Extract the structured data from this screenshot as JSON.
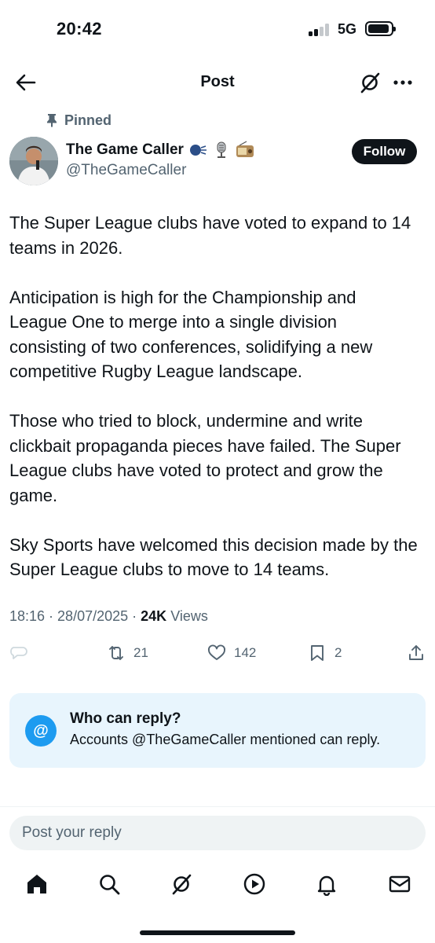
{
  "status_bar": {
    "time": "20:42",
    "network": "5G"
  },
  "header": {
    "title": "Post"
  },
  "post": {
    "pinned_label": "Pinned",
    "author_name": "The Game Caller",
    "author_handle": "@TheGameCaller",
    "follow_label": "Follow",
    "paragraphs": [
      "The Super League clubs have voted to expand to 14 teams in 2026.",
      "Anticipation is high for the Championship and League One to merge into a single division consisting of two conferences, solidifying a new competitive Rugby League landscape.",
      "Those who tried to block, undermine and write clickbait propaganda pieces have failed. The Super League clubs have voted to protect and grow the game.",
      "Sky Sports have welcomed this decision made by the Super League clubs to move to 14 teams."
    ],
    "time": "18:16",
    "date": "28/07/2025",
    "views_count": "24K",
    "views_label": "Views"
  },
  "actions": {
    "reposts": "21",
    "likes": "142",
    "bookmarks": "2"
  },
  "reply_restriction": {
    "title": "Who can reply?",
    "subtitle": "Accounts @TheGameCaller mentioned can reply."
  },
  "reply_input": {
    "placeholder": "Post your reply"
  },
  "icons": {
    "back": "arrow-left-icon",
    "grok": "grok-icon",
    "more": "more-dots-icon",
    "pin": "pin-icon",
    "reply": "comment-icon",
    "repost": "repost-icon",
    "like": "heart-icon",
    "bookmark": "bookmark-icon",
    "share": "share-icon",
    "home": "home-icon",
    "search": "search-icon",
    "video": "play-icon",
    "notifications": "bell-icon",
    "messages": "mail-icon"
  },
  "colors": {
    "accent": "#1d9bf0",
    "text": "#0f1419",
    "secondary": "#536471",
    "reply_box_bg": "#e8f5fd"
  }
}
